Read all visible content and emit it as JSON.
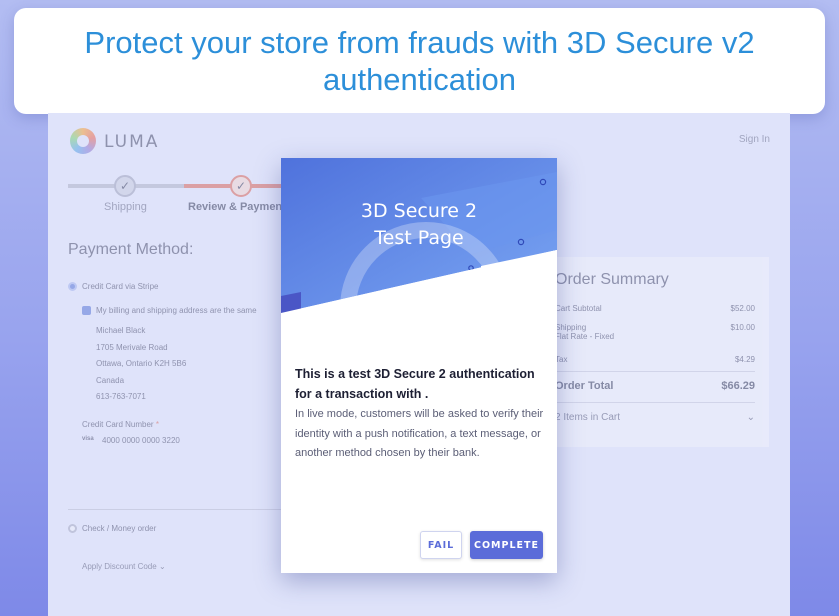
{
  "banner": {
    "text": "Protect your store from frauds with 3D Secure v2 authentication"
  },
  "store": {
    "logo": "LUMA",
    "sign_in": "Sign In",
    "steps": [
      {
        "label": "Shipping"
      },
      {
        "label": "Review & Paymen"
      }
    ],
    "payment_method_title": "Payment Method:",
    "payment_option_card": "Credit Card via Stripe",
    "billing_same_label": "My billing and shipping address are the same",
    "address": [
      "Michael Black",
      "1705 Merivale Road",
      "Ottawa, Ontario K2H 5B6",
      "Canada",
      "613-763-7071"
    ],
    "card_number_label": "Credit Card Number",
    "card_brand": "visa",
    "card_number": "4000 0000 0000 3220",
    "payment_option_check": "Check / Money order",
    "discount_label": "Apply Discount Code"
  },
  "summary": {
    "title": "Order Summary",
    "cart_subtotal_label": "Cart Subtotal",
    "cart_subtotal_value": "$52.00",
    "shipping_label": "Shipping",
    "shipping_method": "Flat Rate - Fixed",
    "shipping_value": "$10.00",
    "tax_label": "Tax",
    "tax_value": "$4.29",
    "order_total_label": "Order Total",
    "order_total_value": "$66.29",
    "items_in_cart": "2 Items in Cart"
  },
  "modal": {
    "title_line1": "3D Secure 2",
    "title_line2": "Test Page",
    "heading": "This is a test 3D Secure 2 authentication for a transaction with .",
    "body": "In live mode, customers will be asked to verify their identity with a push notification, a text message, or another method chosen by their bank.",
    "fail_label": "FAIL",
    "complete_label": "COMPLETE"
  },
  "colors": {
    "banner_text": "#2c8fd9",
    "primary_button": "#5b6cd9",
    "hero_blue": "#5f86e6",
    "accent_red": "#d86a5e"
  }
}
